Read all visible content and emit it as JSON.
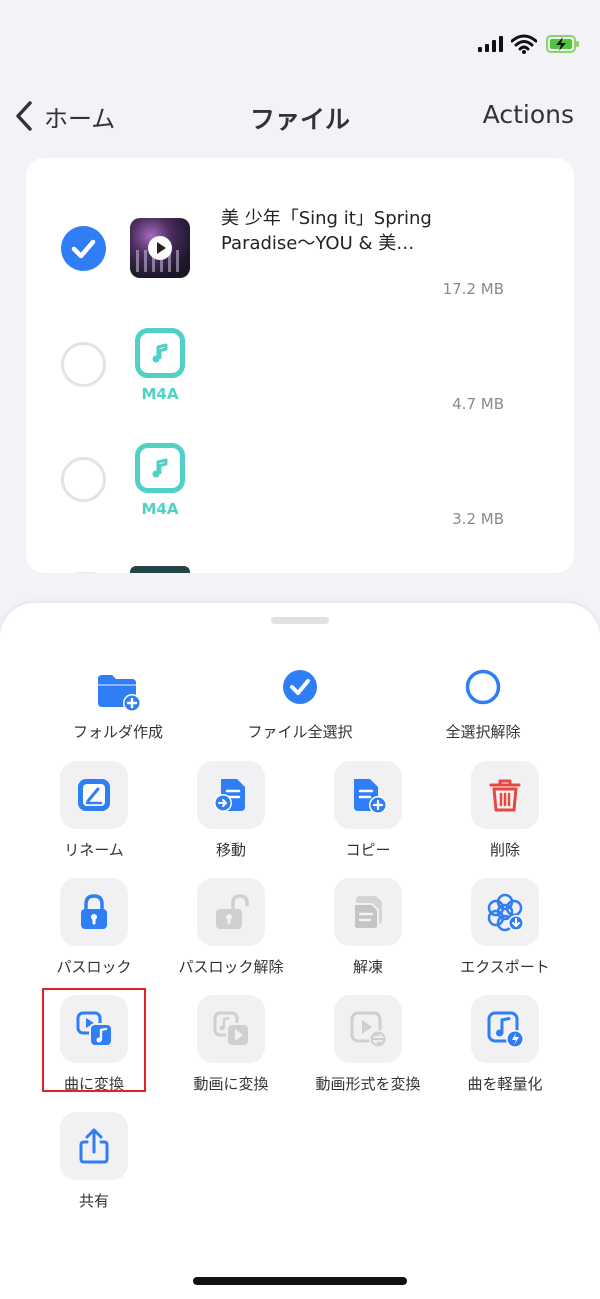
{
  "nav": {
    "back_label": "ホーム",
    "title": "ファイル",
    "actions_label": "Actions"
  },
  "files": [
    {
      "name": "美 少年「Sing it」Spring Paradise〜YOU & 美…",
      "size": "17.2 MB",
      "selected": true,
      "type": "video"
    },
    {
      "name": "",
      "size": "4.7 MB",
      "selected": false,
      "type": "M4A"
    },
    {
      "name": "",
      "size": "3.2 MB",
      "selected": false,
      "type": "M4A"
    }
  ],
  "m4a_label": "M4A",
  "sheet": {
    "top_actions": [
      {
        "label": "フォルダ作成",
        "icon": "folder-add-icon"
      },
      {
        "label": "ファイル全選択",
        "icon": "check-circle-icon"
      },
      {
        "label": "全選択解除",
        "icon": "empty-circle-icon"
      }
    ],
    "tiles": [
      {
        "label": "リネーム",
        "icon": "rename-icon",
        "enabled": true
      },
      {
        "label": "移動",
        "icon": "move-icon",
        "enabled": true
      },
      {
        "label": "コピー",
        "icon": "copy-icon",
        "enabled": true
      },
      {
        "label": "削除",
        "icon": "trash-icon",
        "enabled": true
      },
      {
        "label": "パスロック",
        "icon": "lock-icon",
        "enabled": true
      },
      {
        "label": "パスロック解除",
        "icon": "unlock-icon",
        "enabled": false
      },
      {
        "label": "解凍",
        "icon": "unzip-icon",
        "enabled": false
      },
      {
        "label": "エクスポート",
        "icon": "export-icon",
        "enabled": true
      },
      {
        "label": "曲に変換",
        "icon": "convert-to-song-icon",
        "enabled": true,
        "highlighted": true
      },
      {
        "label": "動画に変換",
        "icon": "convert-to-video-icon",
        "enabled": false
      },
      {
        "label": "動画形式を変換",
        "icon": "video-format-icon",
        "enabled": false
      },
      {
        "label": "曲を軽量化",
        "icon": "compress-song-icon",
        "enabled": true
      },
      {
        "label": "共有",
        "icon": "share-icon",
        "enabled": true
      }
    ]
  },
  "colors": {
    "accent": "#2f7ef5",
    "m4a": "#4fd1c5",
    "danger": "#e8473f",
    "disabled": "#c9c9c9",
    "highlight": "#e02323"
  }
}
